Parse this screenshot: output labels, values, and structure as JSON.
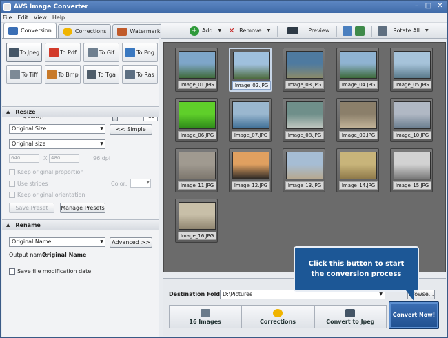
{
  "window": {
    "title": "AVS Image Converter"
  },
  "menu": [
    "File",
    "Edit",
    "View",
    "Help"
  ],
  "tabs": [
    {
      "label": "Conversion",
      "icon": "conversion-icon",
      "color": "#3b6fb5"
    },
    {
      "label": "Corrections",
      "icon": "star-icon",
      "color": "#f0b400"
    },
    {
      "label": "Watermark",
      "icon": "watermark-icon",
      "color": "#c05a2a"
    }
  ],
  "formats": [
    {
      "label": "To Jpeg",
      "icon": "camera-icon",
      "color": "#445566",
      "active": true
    },
    {
      "label": "To Pdf",
      "icon": "pdf-icon",
      "color": "#d23a2a"
    },
    {
      "label": "To Gif",
      "icon": "gif-icon",
      "color": "#6f7f8f"
    },
    {
      "label": "To Png",
      "icon": "png-icon",
      "color": "#3a78c0"
    },
    {
      "label": "To Tiff",
      "icon": "tiff-icon",
      "color": "#7d8a96"
    },
    {
      "label": "To Bmp",
      "icon": "bmp-icon",
      "color": "#c87a2a"
    },
    {
      "label": "To Tga",
      "icon": "tga-icon",
      "color": "#4f5d6a"
    },
    {
      "label": "To Ras",
      "icon": "ras-icon",
      "color": "#5d6f82"
    }
  ],
  "quality": {
    "label": "Quality:",
    "value": "85",
    "fraction": 0.85
  },
  "resize": {
    "header": "Resize",
    "size_mode": "Original Size",
    "simple_btn": "<< Simple",
    "size_preset": "Original size",
    "width": "640",
    "x_label": "X",
    "height": "480",
    "dpi": "96 dpi",
    "keep_proportion": "Keep original proportion",
    "use_stripes": "Use stripes",
    "color_label": "Color:",
    "keep_orientation": "Keep original orientation",
    "save_preset": "Save Preset",
    "manage_presets": "Manage Presets"
  },
  "rename": {
    "header": "Rename",
    "mode": "Original Name",
    "advanced_btn": "Advanced >>",
    "output_label": "Output name:",
    "output_value": "Original Name"
  },
  "save_mod_date": "Save file modification date",
  "toolbar": {
    "add": "Add",
    "remove": "Remove",
    "preview": "Preview",
    "rotate_all": "Rotate All"
  },
  "images": [
    {
      "name": "Image_01.JPG",
      "colors": [
        "#7ea6c9",
        "#3f6b3a"
      ]
    },
    {
      "name": "Image_02.JPG",
      "colors": [
        "#9fc0dd",
        "#4d6b3d"
      ],
      "selected": true
    },
    {
      "name": "Image_03.JPG",
      "colors": [
        "#4e7aa0",
        "#8a8a6a"
      ]
    },
    {
      "name": "Image_04.JPG",
      "colors": [
        "#8fb3d2",
        "#3d6a3a"
      ]
    },
    {
      "name": "Image_05.JPG",
      "colors": [
        "#a6c3da",
        "#5a7a8a"
      ]
    },
    {
      "name": "Image_06.JPG",
      "colors": [
        "#5fcf2a",
        "#2e8a1a"
      ]
    },
    {
      "name": "Image_07.JPG",
      "colors": [
        "#9ab7cf",
        "#3f6f96"
      ]
    },
    {
      "name": "Image_08.JPG",
      "colors": [
        "#6f8f8a",
        "#c2c8c2"
      ]
    },
    {
      "name": "Image_09.JPG",
      "colors": [
        "#8b7f6a",
        "#c4b59a"
      ]
    },
    {
      "name": "Image_10.JPG",
      "colors": [
        "#b0b8c4",
        "#6a7d8e"
      ]
    },
    {
      "name": "Image_11.JPG",
      "colors": [
        "#a09a90",
        "#7d776e"
      ]
    },
    {
      "name": "Image_12.JPG",
      "colors": [
        "#e0a060",
        "#2e2a26"
      ]
    },
    {
      "name": "Image_13.JPG",
      "colors": [
        "#a6bdd4",
        "#b6a990"
      ]
    },
    {
      "name": "Image_14.JPG",
      "colors": [
        "#c8b47a",
        "#8f7a4a"
      ]
    },
    {
      "name": "Image_15.JPG",
      "colors": [
        "#d2d2d2",
        "#7a7a7a"
      ]
    },
    {
      "name": "Image_16.JPG",
      "colors": [
        "#c8bfa8",
        "#8f8570"
      ]
    }
  ],
  "destination": {
    "label": "Destination Folder:",
    "value": "D:\\Pictures",
    "browse": "Browse..."
  },
  "steps": [
    {
      "label": "16 Images",
      "icon": "images-icon",
      "color": "#6a7a8a"
    },
    {
      "label": "Corrections",
      "icon": "star-icon",
      "color": "#f0b400"
    },
    {
      "label": "Convert to Jpeg",
      "icon": "camera-icon",
      "color": "#445566"
    }
  ],
  "convert_btn": "Convert Now!",
  "callout": "Click this button to start the conversion process"
}
